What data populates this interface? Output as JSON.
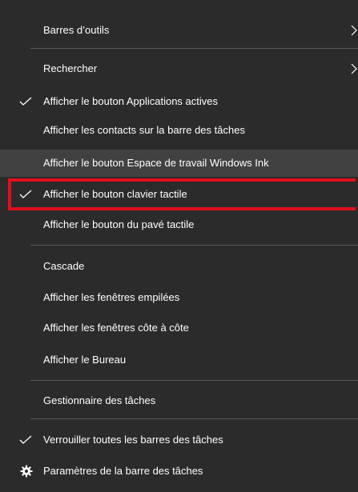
{
  "menu": {
    "items": [
      {
        "label": "Barres d’outils",
        "submenu": true
      },
      {
        "label": "Rechercher",
        "submenu": true
      },
      {
        "label": "Afficher le bouton Applications actives",
        "checked": true
      },
      {
        "label": "Afficher les contacts sur la barre des tâches"
      },
      {
        "label": "Afficher le bouton Espace de travail Windows Ink",
        "hovered": true
      },
      {
        "label": "Afficher le bouton clavier tactile",
        "checked": true
      },
      {
        "label": "Afficher le bouton du pavé tactile"
      },
      {
        "label": "Cascade"
      },
      {
        "label": "Afficher les fenêtres empilées"
      },
      {
        "label": "Afficher les fenêtres côte à côte"
      },
      {
        "label": "Afficher le Bureau"
      },
      {
        "label": "Gestionnaire des tâches"
      },
      {
        "label": "Verrouiller toutes les barres des tâches",
        "checked": true
      },
      {
        "label": "Paramètres de la barre des tâches",
        "icon": "gear-icon"
      }
    ]
  },
  "colors": {
    "menu_background": "#2b2b2b",
    "hover_background": "#414141",
    "separator": "#5a5a5a",
    "annotation_border": "#e0101b"
  }
}
